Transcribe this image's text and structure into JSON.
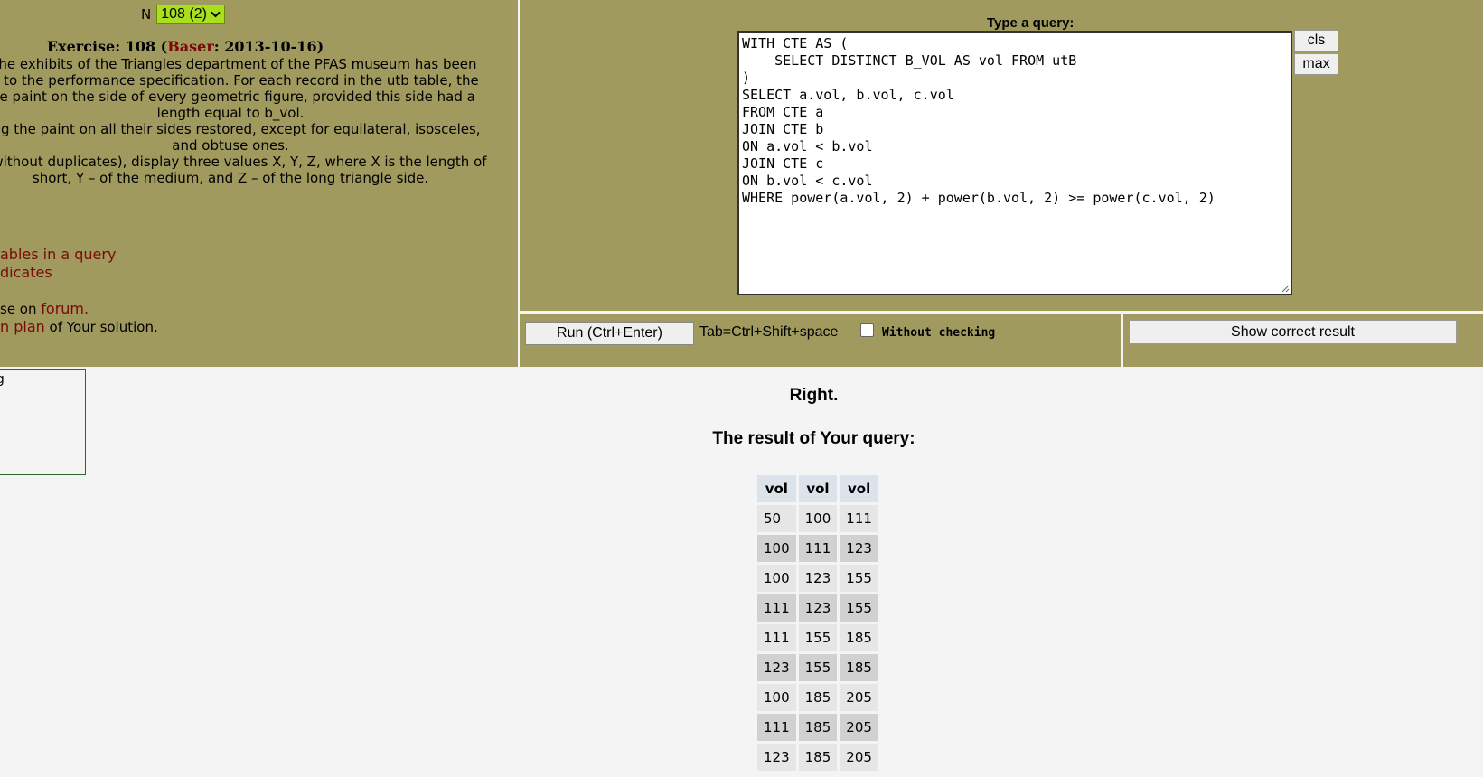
{
  "exercise_selector": {
    "label": "N",
    "selected": "108 (2)"
  },
  "exercise": {
    "title_prefix": "Exercise: 108 (",
    "author": "Baser",
    "title_suffix": ": 2013-10-16)",
    "lines": [
      "f the exhibits of the Triangles department of the PFAS museum has been",
      "ng to the performance specification. For each record in the utb table, the",
      "the paint on the side of every geometric figure, provided this side had a",
      "length equal to b_vol.",
      "ving the paint on all their sides restored, except for equilateral, isosceles,",
      "and obtuse ones.",
      "et without duplicates), display three values X, Y, Z, where X is the length of",
      "short, Y – of the medium, and Z – of the long triangle side."
    ]
  },
  "left_links": {
    "tables_in_query": "ables in a query",
    "predicates": "dicates",
    "forum_prefix": "se on ",
    "forum_link": "forum",
    "forum_suffix": ".",
    "plan_link": "n plan",
    "plan_suffix": " of Your solution."
  },
  "info_box_text": "ng",
  "editor": {
    "label": "Type a query:",
    "query": "WITH CTE AS (\n    SELECT DISTINCT B_VOL AS vol FROM utB\n)\nSELECT a.vol, b.vol, c.vol\nFROM CTE a\nJOIN CTE b\nON a.vol < b.vol\nJOIN CTE c\nON b.vol < c.vol\nWHERE power(a.vol, 2) + power(b.vol, 2) >= power(c.vol, 2)",
    "cls_label": "cls",
    "max_label": "max"
  },
  "controls": {
    "run_label": "Run (Ctrl+Enter)",
    "tab_hint": "Tab=Ctrl+Shift+space",
    "without_checking": "Without checking",
    "without_checking_checked": false,
    "show_correct_label": "Show correct result"
  },
  "result": {
    "status": "Right.",
    "heading": "The result of Your query:",
    "columns": [
      "vol",
      "vol",
      "vol"
    ],
    "rows": [
      [
        "50",
        "100",
        "111"
      ],
      [
        "100",
        "111",
        "123"
      ],
      [
        "100",
        "123",
        "155"
      ],
      [
        "111",
        "123",
        "155"
      ],
      [
        "111",
        "155",
        "185"
      ],
      [
        "123",
        "155",
        "185"
      ],
      [
        "100",
        "185",
        "205"
      ],
      [
        "111",
        "185",
        "205"
      ],
      [
        "123",
        "185",
        "205"
      ]
    ]
  },
  "colors": {
    "panel": "#a09a5e",
    "link": "#7a0a0a",
    "selector": "#a8e01c",
    "background": "#f4f4f4"
  }
}
